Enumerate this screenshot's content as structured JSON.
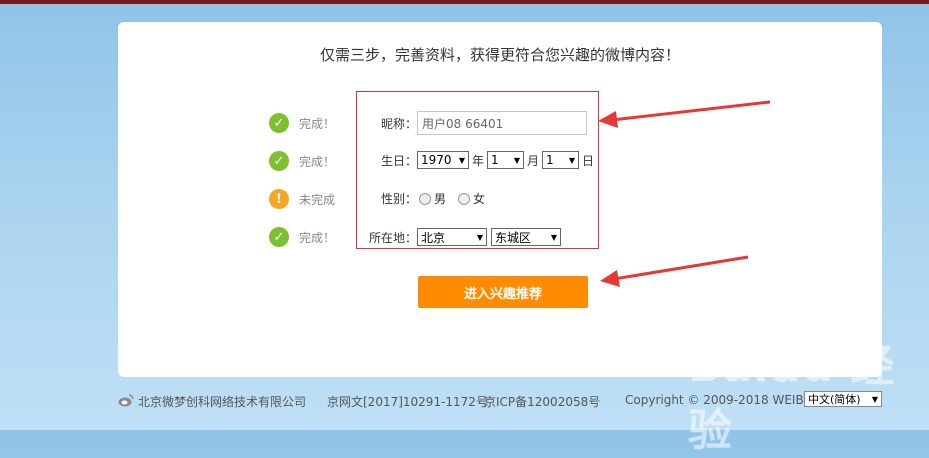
{
  "headline": "仅需三步，完善资料，获得更符合您兴趣的微博内容！",
  "steps": [
    {
      "status": "完成！",
      "icon": "check-icon"
    },
    {
      "status": "完成！",
      "icon": "check-icon"
    },
    {
      "status": "未完成",
      "icon": "exclamation-icon"
    },
    {
      "status": "完成！",
      "icon": "check-icon"
    }
  ],
  "form": {
    "nickname_label": "昵称：",
    "nickname_value": "用户08    66401",
    "birthday_label": "生日：",
    "year": "1970",
    "year_unit": "年",
    "month": "1",
    "month_unit": "月",
    "day": "1",
    "day_unit": "日",
    "gender_label": "性别：",
    "gender_male": "男",
    "gender_female": "女",
    "location_label": "所在地：",
    "province": "北京",
    "district": "东城区"
  },
  "submit_label": "进入兴趣推荐",
  "footer": {
    "company": "北京微梦创科网络技术有限公司",
    "license": "京网文[2017]10291-1172号",
    "icp": "京ICP备12002058号",
    "copyright": "Copyright © 2009-2018 WEIBO",
    "language": "中文(简体)"
  },
  "watermark": "Baidu 经验",
  "colors": {
    "accent": "#ff8c00",
    "ok": "#7cc12f",
    "warn": "#f6a623",
    "highlight": "#d4393c"
  }
}
